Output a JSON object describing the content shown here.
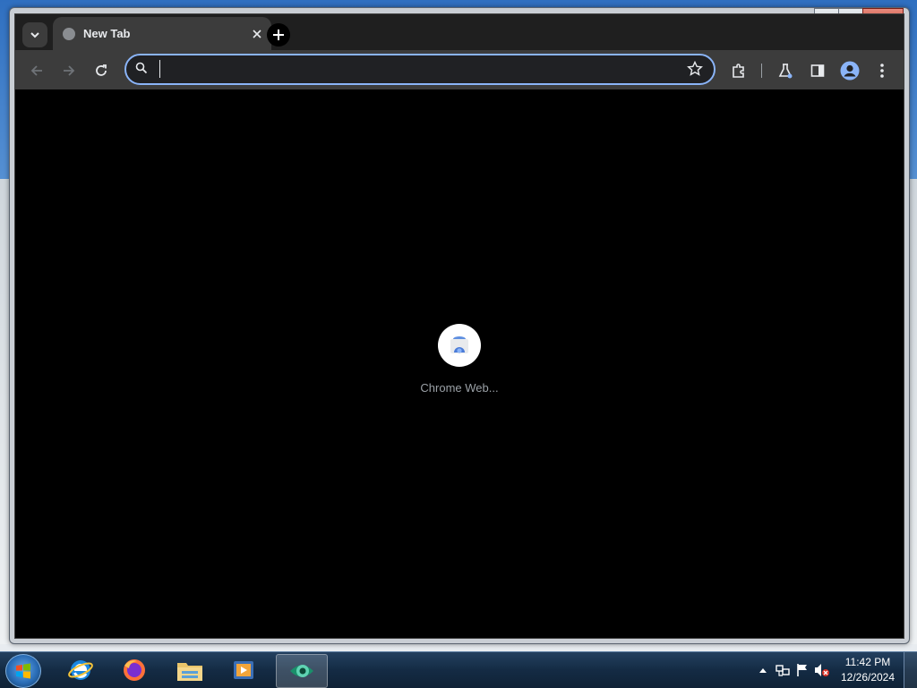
{
  "window": {
    "title": "New Tab"
  },
  "tabs": [
    {
      "title": "New Tab"
    }
  ],
  "omnibox": {
    "value": "",
    "placeholder": ""
  },
  "shortcuts": [
    {
      "label": "Chrome Web..."
    }
  ],
  "taskbar": {
    "apps": [
      "start",
      "internet-explorer",
      "firefox",
      "file-explorer",
      "media-player",
      "chrome-remote-desktop"
    ],
    "clock": {
      "time": "11:42 PM",
      "date": "12/26/2024"
    }
  },
  "colors": {
    "accent": "#8ab4f8",
    "tabstrip": "#1f1f1f",
    "toolbar": "#3c3c3c",
    "content": "#000000",
    "profile": "#8ab4f8"
  }
}
